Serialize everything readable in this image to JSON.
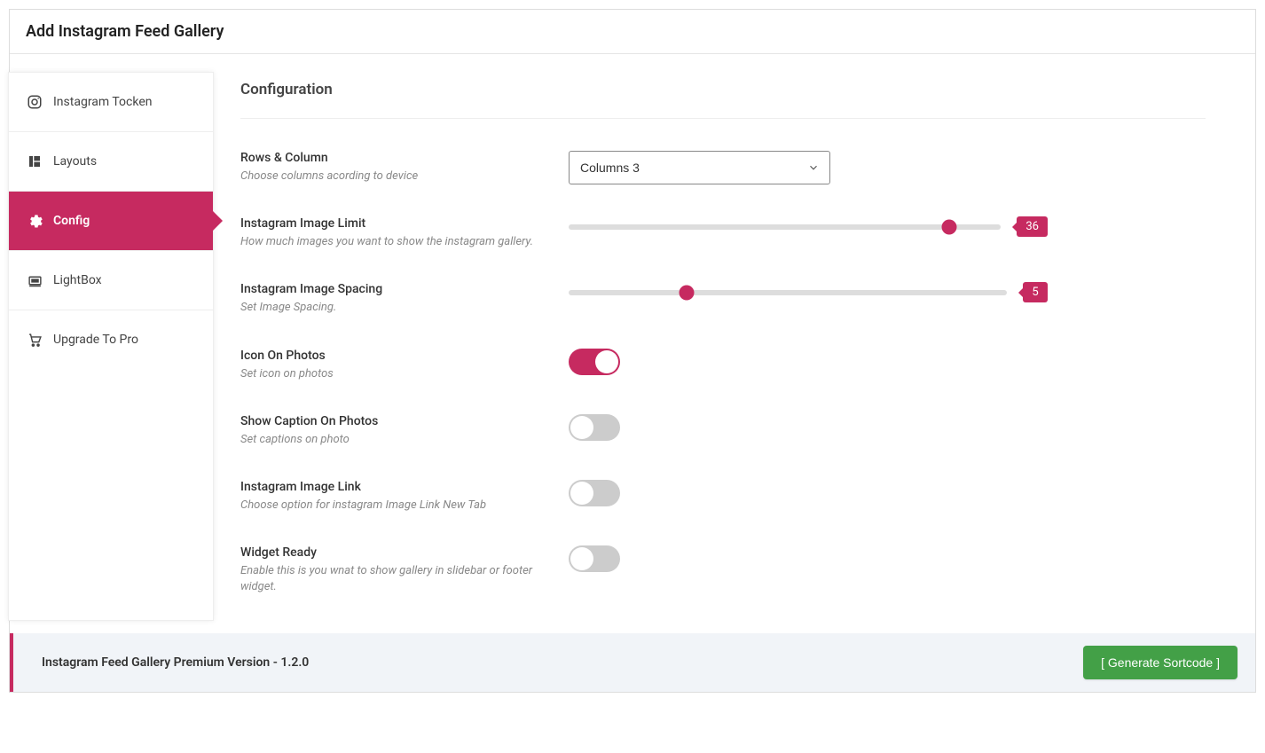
{
  "page_title": "Add Instagram Feed Gallery",
  "sidebar": {
    "items": [
      {
        "label": "Instagram Tocken",
        "active": false
      },
      {
        "label": "Layouts",
        "active": false
      },
      {
        "label": "Config",
        "active": true
      },
      {
        "label": "LightBox",
        "active": false
      },
      {
        "label": "Upgrade To Pro",
        "active": false
      }
    ]
  },
  "section_title": "Configuration",
  "fields": {
    "columns": {
      "label": "Rows & Column",
      "desc": "Choose columns acording to device",
      "value": "Columns 3"
    },
    "image_limit": {
      "label": "Instagram Image Limit",
      "desc": "How much images you want to show the instagram gallery.",
      "value": 36,
      "min": 1,
      "max": 40,
      "percent": 88
    },
    "image_spacing": {
      "label": "Instagram Image Spacing",
      "desc": "Set Image Spacing.",
      "value": 5,
      "min": 0,
      "max": 20,
      "percent": 27
    },
    "icon_on_photos": {
      "label": "Icon On Photos",
      "desc": "Set icon on photos",
      "on": true
    },
    "show_caption": {
      "label": "Show Caption On Photos",
      "desc": "Set captions on photo",
      "on": false
    },
    "image_link": {
      "label": "Instagram Image Link",
      "desc": "Choose option for instagram Image Link New Tab",
      "on": false
    },
    "widget_ready": {
      "label": "Widget Ready",
      "desc": "Enable this is you wnat to show gallery in slidebar or footer widget.",
      "on": false
    }
  },
  "footer": {
    "text": "Instagram Feed Gallery Premium Version - 1.2.0",
    "button": "[ Generate Sortcode ]"
  }
}
